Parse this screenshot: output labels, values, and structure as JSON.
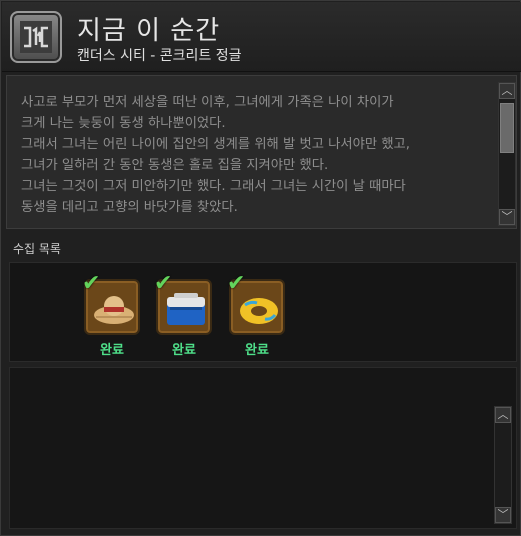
{
  "header": {
    "title": "지금 이 순간",
    "subtitle": "캔더스 시티 - 콘크리트 정글",
    "logo_icon": "bracket-emblem-icon"
  },
  "story": {
    "lines": [
      "사고로 부모가 먼저 세상을 떠난 이후, 그녀에게 가족은 나이 차이가",
      "크게 나는 늦둥이 동생 하나뿐이었다.",
      "그래서 그녀는 어린 나이에 집안의 생계를 위해 발 벗고 나서야만 했고,",
      "그녀가 일하러 간 동안 동생은 홀로 집을 지켜야만 했다.",
      "그녀는 그것이 그저 미안하기만 했다. 그래서 그녀는 시간이 날 때마다",
      "동생을 데리고 고향의 바닷가를 찾았다."
    ]
  },
  "collection": {
    "label": "수집 목록",
    "items": [
      {
        "icon": "straw-hat-icon",
        "status": "완료"
      },
      {
        "icon": "cooler-box-icon",
        "status": "완료"
      },
      {
        "icon": "swim-ring-icon",
        "status": "완료"
      }
    ]
  },
  "colors": {
    "complete": "#4fe08a",
    "check": "#63d35c",
    "slot": "#6b4719"
  }
}
